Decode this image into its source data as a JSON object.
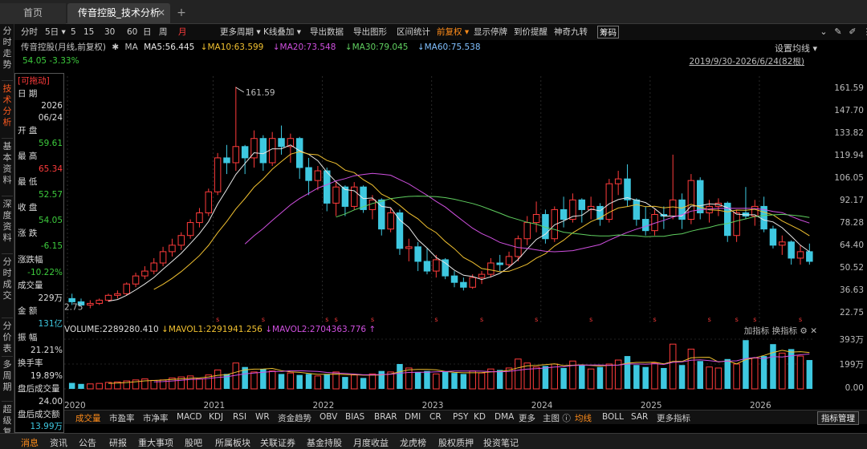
{
  "tabs": {
    "home": "首页",
    "active": "传音控股_技术分析",
    "close": "✕",
    "add": "+"
  },
  "leftnav": [
    {
      "label": "分时走势",
      "active": false
    },
    {
      "label": "技术分析",
      "active": true
    },
    {
      "label": "基本资料",
      "active": false
    },
    {
      "label": "深度资料",
      "active": false
    },
    {
      "label": "分时成交",
      "active": false
    },
    {
      "label": "分价表",
      "active": false
    },
    {
      "label": "多周期",
      "active": false
    },
    {
      "label": "超级复盘",
      "active": false
    }
  ],
  "toolbar": {
    "items": [
      "分时",
      "5日",
      "5",
      "15",
      "30",
      "60",
      "日",
      "周",
      "月",
      "更多周期",
      "K线叠加",
      "导出数据",
      "导出图形",
      "区间统计",
      "前复权",
      "显示停牌",
      "到价提醒",
      "神奇九转",
      "筹码"
    ],
    "icons": [
      "chevron-down-icon",
      "settings-icon",
      "edit-icon",
      "more-icon"
    ]
  },
  "header": {
    "title": "传音控股(月线,前复权)",
    "ma": "MA",
    "ma5": "MA5:56.445",
    "ma10": "MA10:63.599",
    "ma20": "MA20:73.548",
    "ma30": "MA30:79.045",
    "ma60": "MA60:75.538",
    "change": "54.05  -3.33%",
    "setting": "设置均线",
    "range": "2019/9/30-2026/6/24(82根)"
  },
  "info": {
    "drag": "[可拖动]",
    "date_label": "日    期",
    "date_year": "2026",
    "date_md": "06/24",
    "open_label": "开    盘",
    "open": "59.61",
    "high_label": "最    高",
    "high": "65.34",
    "low_label": "最    低",
    "low": "52.57",
    "close_label": "收    盘",
    "close": "54.05",
    "chg_label": "涨    跌",
    "chg": "-6.15",
    "pct_label": "涨跌幅",
    "pct": "-10.22%",
    "vol_label": "成交量",
    "vol": "229万",
    "amt_label": "金    额",
    "amt": "131亿",
    "amp_label": "振    幅",
    "amp": "21.21%",
    "turn_label": "换手率",
    "turn": "19.89%",
    "ah_vol_label": "盘后成交量",
    "ah_vol": "24.00",
    "ah_amt_label": "盘后成交额",
    "ah_amt": "13.99万"
  },
  "volume_header": {
    "volume": "VOLUME:2289280.410",
    "mavol1": "MAVOL1:2291941.256",
    "mavol2": "MAVOL2:2704363.776",
    "tools": "加指标 换指标"
  },
  "chart_data": {
    "type": "candlestick",
    "yaxis": [
      "161.59",
      "147.70",
      "133.82",
      "119.94",
      "106.05",
      "92.17",
      "78.28",
      "64.40",
      "50.52",
      "36.63",
      "22.75"
    ],
    "ylim": [
      22.75,
      161.59
    ],
    "vol_yaxis": [
      "393万",
      "199万",
      "0.00"
    ],
    "xaxis": [
      "2020",
      "2021",
      "2022",
      "2023",
      "2024",
      "2025",
      "2026"
    ],
    "annotations": [
      "161.59",
      "2.75"
    ],
    "ohlc": [
      [
        31,
        34,
        27,
        29
      ],
      [
        29,
        31,
        26,
        27
      ],
      [
        27,
        30,
        25,
        28
      ],
      [
        28,
        31,
        27,
        30
      ],
      [
        30,
        34,
        29,
        33
      ],
      [
        33,
        36,
        31,
        34
      ],
      [
        34,
        41,
        33,
        40
      ],
      [
        40,
        47,
        38,
        45
      ],
      [
        45,
        51,
        43,
        48
      ],
      [
        48,
        56,
        46,
        53
      ],
      [
        53,
        63,
        51,
        60
      ],
      [
        60,
        68,
        57,
        64
      ],
      [
        64,
        72,
        61,
        70
      ],
      [
        70,
        80,
        68,
        78
      ],
      [
        78,
        87,
        75,
        84
      ],
      [
        84,
        99,
        82,
        97
      ],
      [
        97,
        121,
        95,
        118
      ],
      [
        118,
        126,
        108,
        115
      ],
      [
        115,
        162,
        110,
        125
      ],
      [
        125,
        126,
        108,
        118
      ],
      [
        118,
        135,
        112,
        130
      ],
      [
        130,
        132,
        110,
        115
      ],
      [
        115,
        134,
        113,
        130
      ],
      [
        130,
        138,
        120,
        125
      ],
      [
        125,
        133,
        115,
        130
      ],
      [
        130,
        131,
        105,
        112
      ],
      [
        112,
        118,
        95,
        104
      ],
      [
        104,
        113,
        98,
        110
      ],
      [
        110,
        112,
        85,
        90
      ],
      [
        90,
        103,
        82,
        100
      ],
      [
        100,
        101,
        82,
        88
      ],
      [
        88,
        103,
        86,
        100
      ],
      [
        100,
        101,
        84,
        86
      ],
      [
        86,
        95,
        80,
        92
      ],
      [
        92,
        93,
        70,
        74
      ],
      [
        74,
        87,
        72,
        84
      ],
      [
        84,
        86,
        58,
        62
      ],
      [
        62,
        68,
        54,
        63
      ],
      [
        63,
        66,
        48,
        54
      ],
      [
        54,
        62,
        46,
        48
      ],
      [
        48,
        58,
        44,
        55
      ],
      [
        55,
        56,
        43,
        45
      ],
      [
        45,
        48,
        38,
        41
      ],
      [
        41,
        44,
        36,
        38
      ],
      [
        38,
        46,
        37,
        44
      ],
      [
        44,
        48,
        40,
        46
      ],
      [
        46,
        56,
        44,
        53
      ],
      [
        53,
        58,
        48,
        52
      ],
      [
        52,
        60,
        50,
        57
      ],
      [
        57,
        70,
        54,
        68
      ],
      [
        68,
        82,
        64,
        78
      ],
      [
        78,
        91,
        72,
        83
      ],
      [
        83,
        86,
        65,
        68
      ],
      [
        68,
        88,
        66,
        86
      ],
      [
        86,
        94,
        75,
        80
      ],
      [
        80,
        96,
        78,
        92
      ],
      [
        92,
        93,
        78,
        86
      ],
      [
        86,
        94,
        80,
        88
      ],
      [
        88,
        90,
        76,
        80
      ],
      [
        80,
        105,
        78,
        102
      ],
      [
        102,
        110,
        95,
        105
      ],
      [
        105,
        114,
        88,
        92
      ],
      [
        92,
        93,
        76,
        80
      ],
      [
        80,
        88,
        70,
        73
      ],
      [
        73,
        86,
        70,
        83
      ],
      [
        83,
        88,
        74,
        82
      ],
      [
        82,
        120,
        80,
        92
      ],
      [
        92,
        96,
        74,
        80
      ],
      [
        80,
        108,
        77,
        104
      ],
      [
        104,
        106,
        80,
        84
      ],
      [
        84,
        92,
        78,
        88
      ],
      [
        88,
        93,
        82,
        90
      ],
      [
        90,
        91,
        66,
        70
      ],
      [
        70,
        86,
        66,
        84
      ],
      [
        84,
        100,
        80,
        82
      ],
      [
        82,
        92,
        76,
        88
      ],
      [
        88,
        94,
        72,
        74
      ],
      [
        74,
        76,
        62,
        64
      ],
      [
        64,
        70,
        58,
        66
      ],
      [
        66,
        67,
        52,
        56
      ],
      [
        56,
        64,
        52,
        60
      ],
      [
        60,
        65,
        52,
        54
      ]
    ],
    "volume": [
      0.12,
      0.1,
      0.1,
      0.11,
      0.13,
      0.14,
      0.16,
      0.18,
      0.2,
      0.17,
      0.18,
      0.22,
      0.24,
      0.26,
      0.2,
      0.28,
      0.38,
      0.3,
      0.52,
      0.44,
      0.34,
      0.4,
      0.36,
      0.3,
      0.32,
      0.28,
      0.3,
      0.26,
      0.3,
      0.34,
      0.24,
      0.28,
      0.22,
      0.3,
      0.36,
      0.34,
      0.5,
      0.42,
      0.34,
      0.36,
      0.3,
      0.34,
      0.32,
      0.3,
      0.36,
      0.32,
      0.4,
      0.38,
      0.42,
      0.6,
      0.52,
      0.44,
      0.46,
      0.5,
      0.42,
      0.56,
      0.48,
      0.4,
      0.44,
      0.5,
      0.58,
      0.66,
      0.48,
      0.44,
      0.52,
      0.42,
      0.9,
      0.48,
      0.8,
      0.56,
      0.44,
      0.42,
      0.6,
      0.5,
      0.98,
      0.62,
      0.66,
      0.9,
      0.72,
      0.8,
      0.66,
      0.58
    ]
  },
  "indicators": [
    "成交量",
    "市盈率",
    "市净率",
    "MACD",
    "KDJ",
    "RSI",
    "WR",
    "资金趋势",
    "OBV",
    "BIAS",
    "BRAR",
    "DMI",
    "CR",
    "PSY",
    "KD",
    "DMA",
    "更多"
  ],
  "indicators2": [
    "主图",
    "均线",
    "BOLL",
    "SAR",
    "更多指标"
  ],
  "indicator_mgmt": "指标管理",
  "bottom_tabs": [
    "消息",
    "资讯",
    "公告",
    "研报",
    "重大事项",
    "股吧",
    "所属板块",
    "关联证券",
    "基金持股",
    "月度收益",
    "龙虎榜",
    "股权质押",
    "投资笔记"
  ],
  "colors": {
    "up": "#ff3b3b",
    "down": "#3ec8e0",
    "ma5": "#e8e8e8",
    "ma10": "#f0c030",
    "ma20": "#d050e0",
    "ma30": "#60d060",
    "ma60": "#80c0ff"
  }
}
